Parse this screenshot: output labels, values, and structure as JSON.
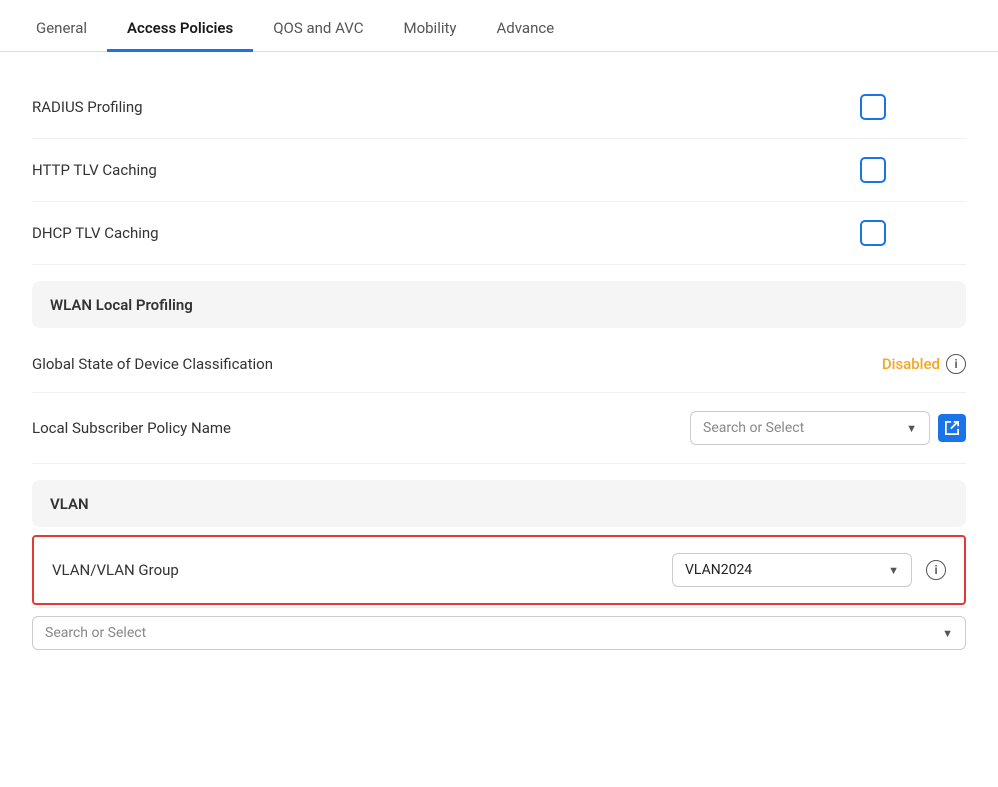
{
  "tabs": [
    {
      "id": "general",
      "label": "General",
      "active": false
    },
    {
      "id": "access-policies",
      "label": "Access Policies",
      "active": true
    },
    {
      "id": "qos-avc",
      "label": "QOS and AVC",
      "active": false
    },
    {
      "id": "mobility",
      "label": "Mobility",
      "active": false
    },
    {
      "id": "advance",
      "label": "Advance",
      "active": false
    }
  ],
  "fields": [
    {
      "id": "radius-profiling",
      "label": "RADIUS Profiling",
      "type": "checkbox",
      "checked": false
    },
    {
      "id": "http-tlv-caching",
      "label": "HTTP TLV Caching",
      "type": "checkbox",
      "checked": false
    },
    {
      "id": "dhcp-tlv-caching",
      "label": "DHCP TLV Caching",
      "type": "checkbox",
      "checked": false
    }
  ],
  "wlan_section": {
    "header": "WLAN Local Profiling",
    "global_state": {
      "label": "Global State of Device Classification",
      "status": "Disabled",
      "has_info": true
    },
    "subscriber_policy": {
      "label": "Local Subscriber Policy Name",
      "placeholder": "Search or Select",
      "has_external_link": true
    }
  },
  "vlan_section": {
    "header": "VLAN",
    "vlan_group": {
      "label": "VLAN/VLAN Group",
      "value": "VLAN2024",
      "has_info": true
    },
    "bottom_placeholder": "Search or Select"
  },
  "icons": {
    "dropdown_arrow": "▼",
    "info": "i",
    "external_link": "↗"
  },
  "colors": {
    "active_tab_underline": "#1a73e8",
    "checkbox_border": "#1a73e8",
    "disabled_status": "#f5a623",
    "highlight_border": "#e53935",
    "ext_link_bg": "#1a73e8"
  }
}
